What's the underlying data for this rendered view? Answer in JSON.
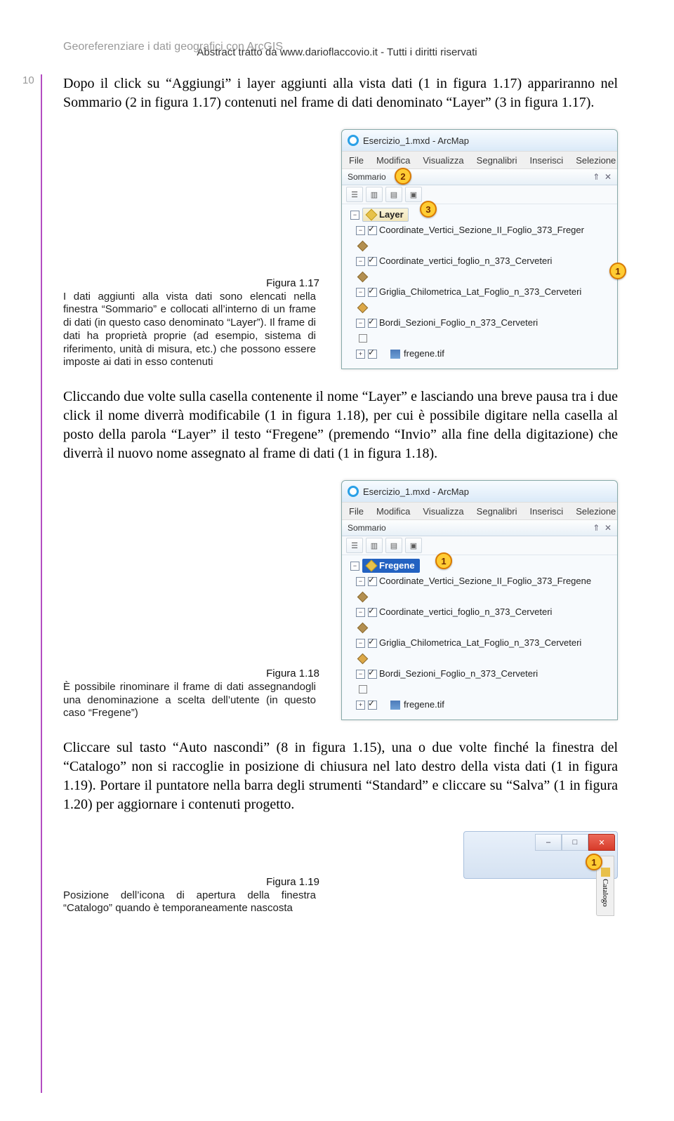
{
  "watermark": "Abstract tratto da www.darioflaccovio.it - Tutti i diritti riservati",
  "page_number": "10",
  "running_head": "Georeferenziare i dati geografici con ArcGIS",
  "para1": "Dopo il click su “Aggiungi” i layer aggiunti alla vista dati (1 in figura 1.17) appariranno nel Sommario (2 in figura 1.17) contenuti nel frame di dati denominato “Layer” (3 in figura 1.17).",
  "fig117": {
    "label": "Figura 1.17",
    "caption": "I dati aggiunti alla vista dati sono elencati nella finestra “Sommario” e collocati all’interno di un frame di dati (in questo caso denominato “Layer”). Il frame di dati ha proprietà proprie (ad esempio, sistema di riferimento, unità di misura, etc.) che possono essere imposte ai dati in esso contenuti",
    "window_title": "Esercizio_1.mxd - ArcMap",
    "menus": [
      "File",
      "Modifica",
      "Visualizza",
      "Segnalibri",
      "Inserisci",
      "Selezione"
    ],
    "panel_label": "Sommario",
    "pin_glyph": "⇑",
    "close_glyph": "✕",
    "t1": "☰",
    "t2": "▥",
    "t3": "▤",
    "t4": "▣",
    "frame_label": "Layer",
    "items": {
      "i0": "Coordinate_Vertici_Sezione_II_Foglio_373_Freger",
      "i1": "Coordinate_vertici_foglio_n_373_Cerveteri",
      "i2": "Griglia_Chilometrica_Lat_Foglio_n_373_Cerveteri",
      "i3": "Bordi_Sezioni_Foglio_n_373_Cerveteri",
      "i4": "fregene.tif"
    },
    "c1": "1",
    "c2": "2",
    "c3": "3"
  },
  "para2": "Cliccando due volte sulla casella contenente il nome “Layer” e lasciando una breve pausa tra i due click il nome diverrà modificabile (1 in figura 1.18), per cui è possibile digitare nella casella al posto della parola “Layer” il testo “Fregene” (premendo “Invio” alla fine della digitazione) che diverrà il nuovo nome assegnato al frame di dati (1 in figura 1.18).",
  "fig118": {
    "label": "Figura 1.18",
    "caption": "È possibile rinominare il frame di dati assegnandogli una denominazione a scelta dell’utente (in questo caso “Fregene”)",
    "window_title": "Esercizio_1.mxd - ArcMap",
    "menus": [
      "File",
      "Modifica",
      "Visualizza",
      "Segnalibri",
      "Inserisci",
      "Selezione"
    ],
    "panel_label": "Sommario",
    "frame_label": "Fregene",
    "items": {
      "i0": "Coordinate_Vertici_Sezione_II_Foglio_373_Fregene",
      "i1": "Coordinate_vertici_foglio_n_373_Cerveteri",
      "i2": "Griglia_Chilometrica_Lat_Foglio_n_373_Cerveteri",
      "i3": "Bordi_Sezioni_Foglio_n_373_Cerveteri",
      "i4": "fregene.tif"
    },
    "c1": "1"
  },
  "para3": "Cliccare sul tasto “Auto nascondi” (8 in figura 1.15), una o due volte finché la finestra del “Catalogo” non si raccoglie in posizione di chiusura nel lato destro della vista dati (1 in figura 1.19). Portare il puntatore nella barra degli strumenti “Standard” e cliccare su “Salva” (1 in figura 1.20) per aggiornare i contenuti progetto.",
  "fig119": {
    "label": "Figura 1.19",
    "caption": "Posizione dell’icona di apertura della finestra “Catalogo” quando è temporaneamente nascosta",
    "min": "–",
    "max": "□",
    "close": "✕",
    "catalog": "Catalogo",
    "c1": "1"
  }
}
